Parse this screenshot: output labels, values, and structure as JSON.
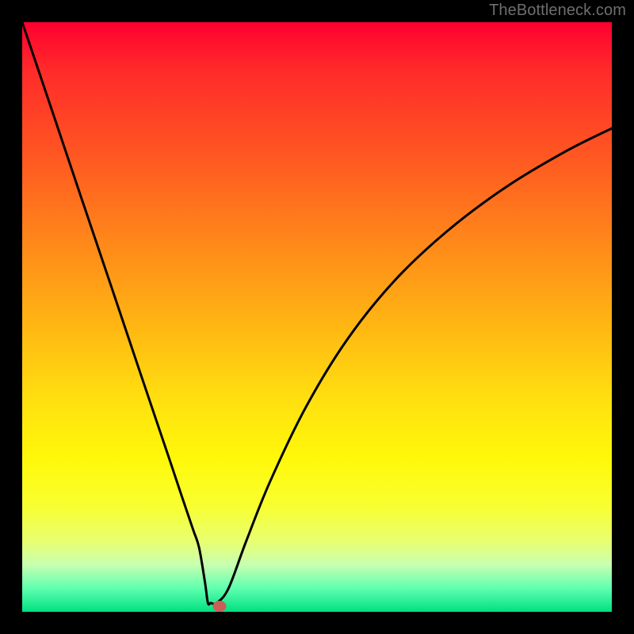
{
  "watermark": "TheBottleneck.com",
  "colors": {
    "background": "#000000",
    "curve": "#000000",
    "marker": "#c86058"
  },
  "chart_data": {
    "type": "line",
    "title": "",
    "xlabel": "",
    "ylabel": "",
    "xlim": [
      0,
      100
    ],
    "ylim": [
      0,
      100
    ],
    "grid": false,
    "series": [
      {
        "name": "bottleneck-curve",
        "x": [
          0,
          5,
          10,
          15,
          20,
          25,
          27,
          29,
          30,
          31,
          31.5,
          32,
          33,
          35,
          38,
          42,
          48,
          55,
          63,
          72,
          82,
          92,
          100
        ],
        "y": [
          100,
          85.2,
          70.3,
          55.5,
          40.6,
          25.8,
          19.8,
          13.9,
          10.9,
          5.0,
          1.5,
          1.5,
          1.5,
          4.0,
          12.0,
          22.0,
          34.5,
          46.0,
          56.0,
          64.5,
          72.0,
          78.0,
          82.0
        ]
      }
    ],
    "annotations": [
      {
        "name": "optimal-point",
        "type": "marker",
        "x": 33.5,
        "y": 1.0
      }
    ]
  }
}
